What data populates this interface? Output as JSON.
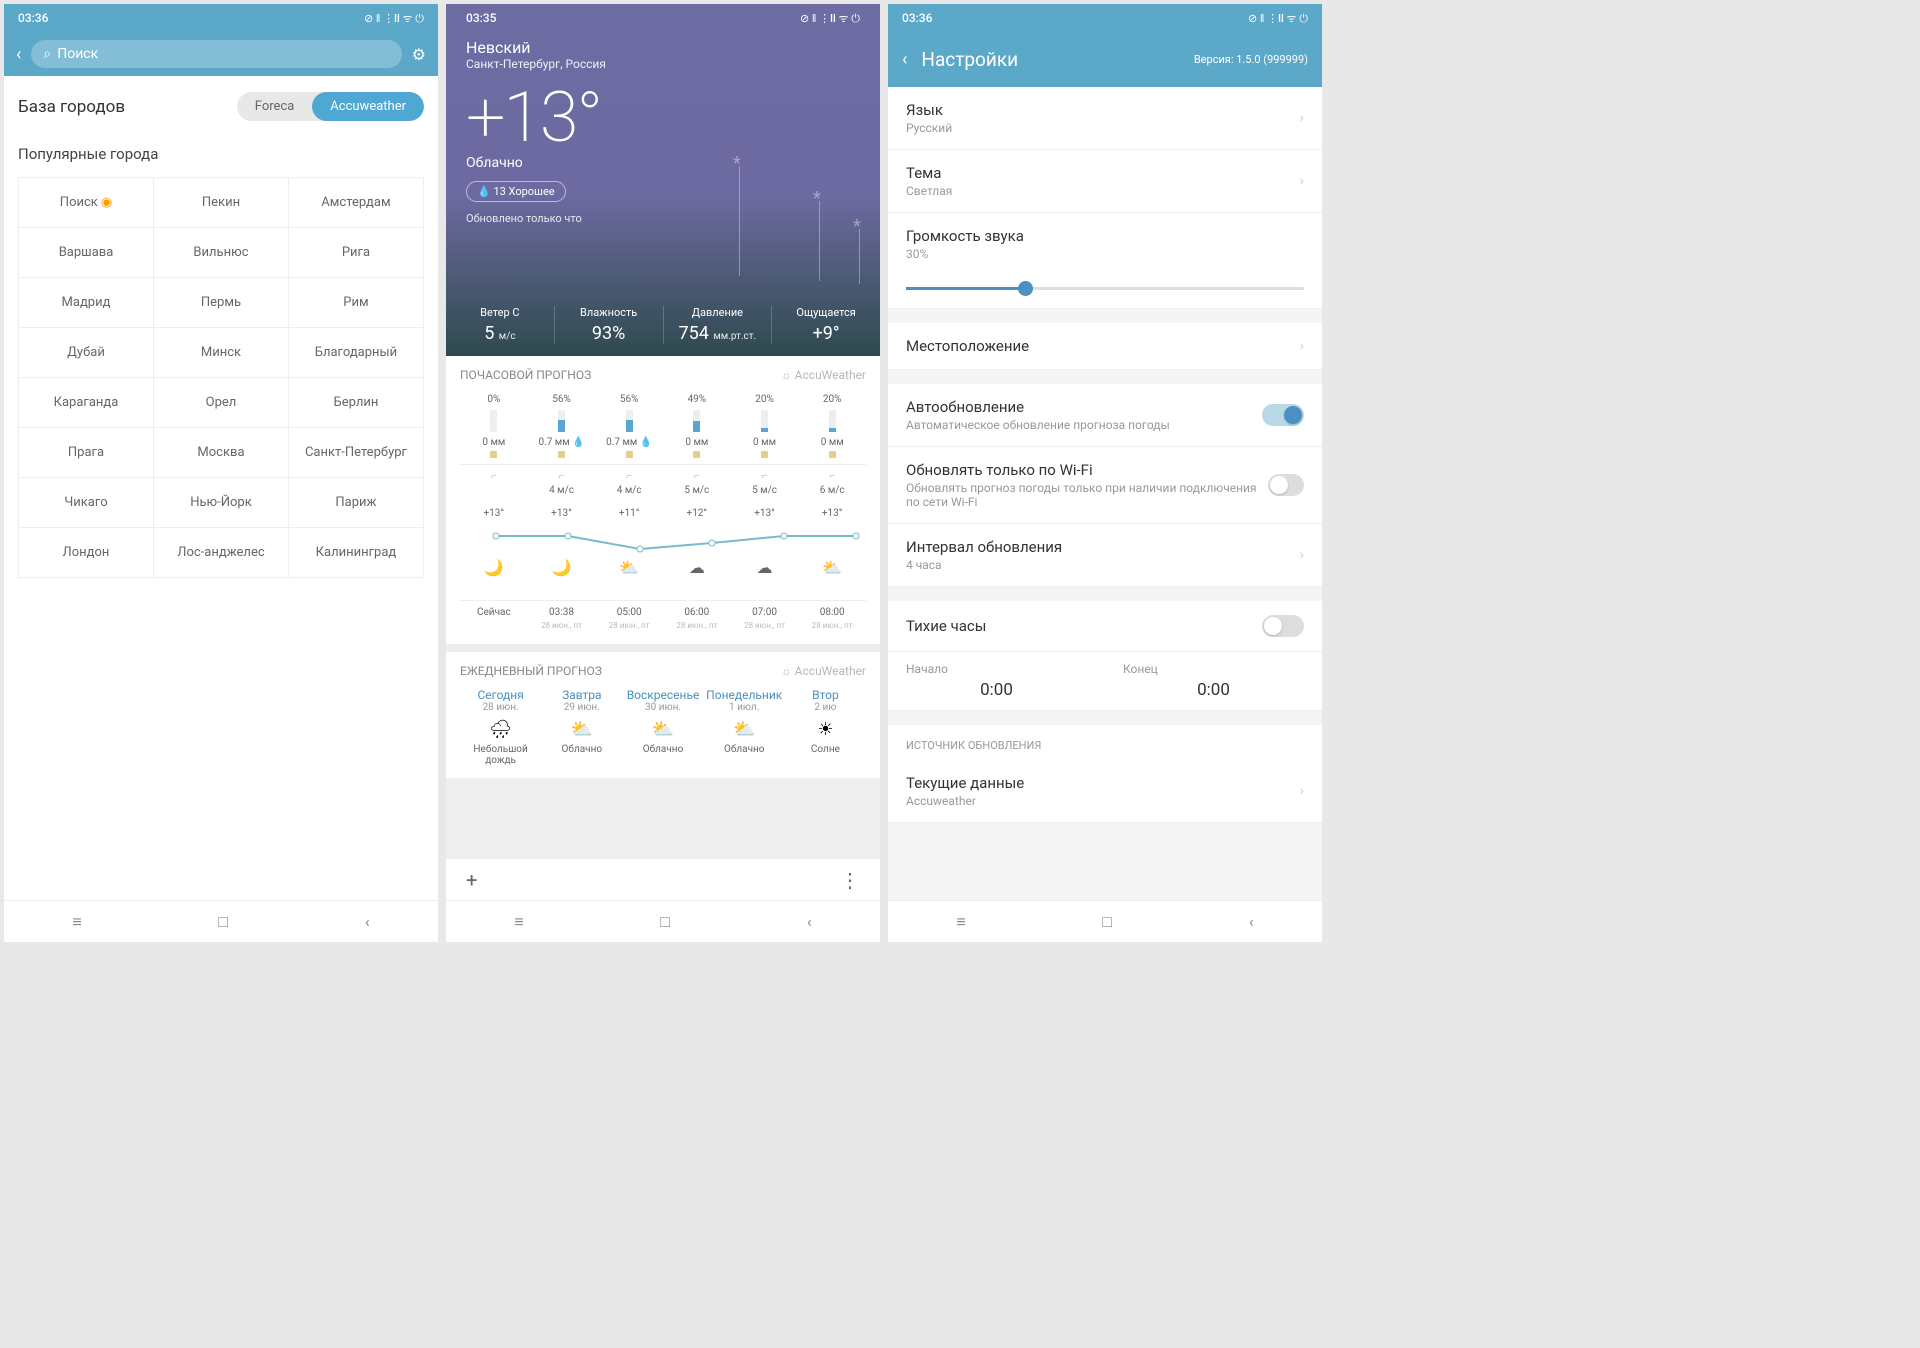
{
  "status": {
    "time1": "03:36",
    "time2": "03:35",
    "time3": "03:36"
  },
  "p1": {
    "search_placeholder": "Поиск",
    "db_title": "База городов",
    "tab_foreca": "Foreca",
    "tab_accu": "Accuweather",
    "popular": "Популярные города",
    "cities": [
      "Поиск",
      "Пекин",
      "Амстердам",
      "Варшава",
      "Вильнюс",
      "Рига",
      "Мадрид",
      "Пермь",
      "Рим",
      "Дубай",
      "Минск",
      "Благодарный",
      "Караганда",
      "Орел",
      "Берлин",
      "Прага",
      "Москва",
      "Санкт-Петербург",
      "Чикаго",
      "Нью-Йорк",
      "Париж",
      "Лондон",
      "Лос-анджелес",
      "Калининград"
    ]
  },
  "p2": {
    "loc": "Невский",
    "subloc": "Санкт-Петербург, Россия",
    "temp": "+13°",
    "cond": "Облачно",
    "chip": "13 Хорошее",
    "upd": "Обновлено только что",
    "stats": {
      "wind_l": "Ветер С",
      "wind_v": "5",
      "wind_u": "м/с",
      "hum_l": "Влажность",
      "hum_v": "93%",
      "pres_l": "Давление",
      "pres_v": "754",
      "pres_u": "мм.рт.ст.",
      "feel_l": "Ощущается",
      "feel_v": "+9°"
    },
    "hourly_hd": "ПОЧАСОВОЙ ПРОГНОЗ",
    "aw": "AccuWeather",
    "hours": [
      {
        "p": "0%",
        "mm": "0 мм",
        "ws": "",
        "t": "+13°",
        "time": "Сейчас",
        "date": ""
      },
      {
        "p": "56%",
        "mm": "0.7 мм",
        "ws": "4 м/с",
        "t": "+13°",
        "time": "03:38",
        "date": "28 июн., пт"
      },
      {
        "p": "56%",
        "mm": "0.7 мм",
        "ws": "4 м/с",
        "t": "+11°",
        "time": "05:00",
        "date": "28 июн., пт"
      },
      {
        "p": "49%",
        "mm": "0 мм",
        "ws": "5 м/с",
        "t": "+12°",
        "time": "06:00",
        "date": "28 июн., пт"
      },
      {
        "p": "20%",
        "mm": "0 мм",
        "ws": "5 м/с",
        "t": "+13°",
        "time": "07:00",
        "date": "28 июн., пт"
      },
      {
        "p": "20%",
        "mm": "0 мм",
        "ws": "6 м/с",
        "t": "+13°",
        "time": "08:00",
        "date": "28 июн., пт"
      }
    ],
    "daily_hd": "ЕЖЕДНЕВНЫЙ ПРОГНОЗ",
    "days": [
      {
        "n": "Сегодня",
        "d": "28 июн.",
        "l": "Небольшой дождь",
        "i": "🌧"
      },
      {
        "n": "Завтра",
        "d": "29 июн.",
        "l": "Облачно",
        "i": "⛅"
      },
      {
        "n": "Воскресенье",
        "d": "30 июн.",
        "l": "Облачно",
        "i": "⛅"
      },
      {
        "n": "Понедельник",
        "d": "1 июл.",
        "l": "Облачно",
        "i": "⛅"
      },
      {
        "n": "Втор",
        "d": "2 ию",
        "l": "Солне",
        "i": "☀"
      }
    ]
  },
  "p3": {
    "title": "Настройки",
    "version": "Версия: 1.5.0 (999999)",
    "lang_l": "Язык",
    "lang_v": "Русский",
    "theme_l": "Тема",
    "theme_v": "Светлая",
    "vol_l": "Громкость звука",
    "vol_v": "30%",
    "loc": "Местоположение",
    "auto_l": "Автообновление",
    "auto_s": "Автоматическое обновление прогноза погоды",
    "wifi_l": "Обновлять только по Wi-Fi",
    "wifi_s": "Обновлять прогноз погоды только при наличии подключения по сети Wi-Fi",
    "int_l": "Интервал обновления",
    "int_v": "4 часа",
    "quiet": "Тихие часы",
    "start_l": "Начало",
    "start_v": "0:00",
    "end_l": "Конец",
    "end_v": "0:00",
    "src_hd": "ИСТОЧНИК ОБНОВЛЕНИЯ",
    "cur_l": "Текущие данные",
    "cur_v": "Accuweather"
  }
}
